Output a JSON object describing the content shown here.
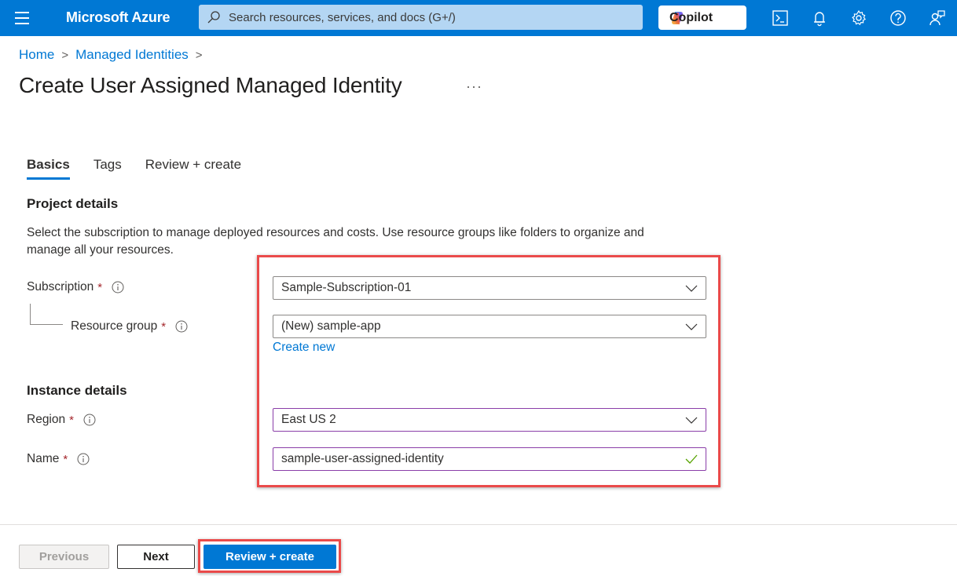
{
  "topbar": {
    "brand": "Microsoft Azure",
    "search_placeholder": "Search resources, services, and docs (G+/)",
    "copilot_label": "Copilot",
    "icons": [
      "cloud-shell-icon",
      "notifications-bell-icon",
      "settings-gear-icon",
      "help-question-icon",
      "feedback-person-icon"
    ],
    "color": "#0078d4"
  },
  "breadcrumb": {
    "items": [
      "Home",
      "Managed Identities"
    ]
  },
  "page": {
    "title": "Create User Assigned Managed Identity",
    "more_label": "···"
  },
  "tabs": [
    {
      "label": "Basics",
      "active": true
    },
    {
      "label": "Tags",
      "active": false
    },
    {
      "label": "Review + create",
      "active": false
    }
  ],
  "project_details": {
    "heading": "Project details",
    "description": "Select the subscription to manage deployed resources and costs. Use resource groups like folders to organize and manage all your resources.",
    "subscription": {
      "label": "Subscription",
      "required": "*",
      "value": "Sample-Subscription-01"
    },
    "resource_group": {
      "label": "Resource group",
      "required": "*",
      "value": "(New) sample-app",
      "create_new_label": "Create new"
    }
  },
  "instance_details": {
    "heading": "Instance details",
    "region": {
      "label": "Region",
      "required": "*",
      "value": "East US 2"
    },
    "name": {
      "label": "Name",
      "required": "*",
      "value": "sample-user-assigned-identity",
      "valid": true
    }
  },
  "footer": {
    "previous_label": "Previous",
    "next_label": "Next",
    "review_create_label": "Review + create"
  },
  "colors": {
    "accent": "#0078d4",
    "required": "#a4262c",
    "highlight": "#ea4a4a",
    "valid": "#57a300"
  }
}
